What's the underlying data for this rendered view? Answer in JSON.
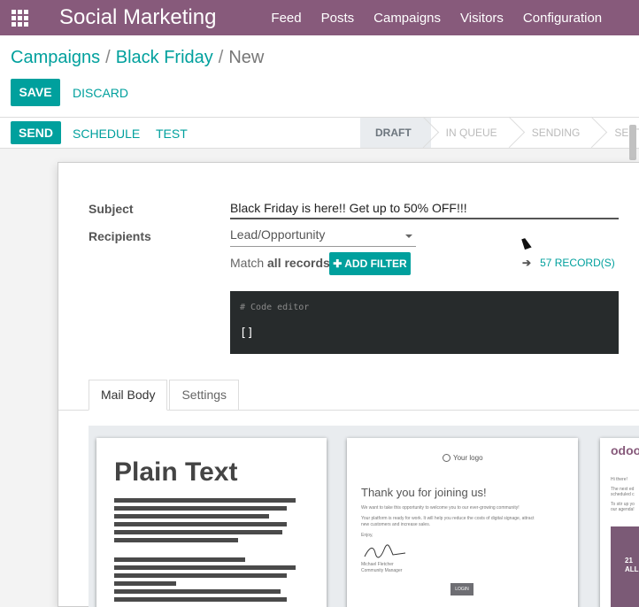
{
  "navbar": {
    "app_title": "Social Marketing",
    "menu": [
      {
        "label": "Feed"
      },
      {
        "label": "Posts"
      },
      {
        "label": "Campaigns"
      },
      {
        "label": "Visitors"
      },
      {
        "label": "Configuration"
      }
    ],
    "brand_color": "#875a7b"
  },
  "breadcrumb": {
    "items": [
      "Campaigns",
      "Black Friday"
    ],
    "current": "New",
    "separator": "/"
  },
  "actions": {
    "save_label": "SAVE",
    "discard_label": "DISCARD"
  },
  "statusbar": {
    "buttons": {
      "send": "SEND",
      "schedule": "SCHEDULE",
      "test": "TEST"
    },
    "stages": [
      {
        "label": "DRAFT",
        "active": true
      },
      {
        "label": "IN QUEUE",
        "active": false
      },
      {
        "label": "SENDING",
        "active": false
      },
      {
        "label": "SENT",
        "active": false
      }
    ]
  },
  "form": {
    "subject_label": "Subject",
    "subject_value": "Black Friday is here!! Get up to 50% OFF!!!",
    "recipients_label": "Recipients",
    "recipients_value": "Lead/Opportunity",
    "match_prefix": "Match",
    "match_bold": "all records",
    "add_filter_label": "ADD FILTER",
    "records_label": "57 RECORD(S)",
    "code_comment": "# Code editor",
    "code_value": "[]",
    "accent_color": "#00a09d"
  },
  "tabs": [
    {
      "label": "Mail Body",
      "active": true
    },
    {
      "label": "Settings",
      "active": false
    }
  ],
  "templates": {
    "plain_text_title": "Plain Text",
    "welcome_logo": "Your logo",
    "welcome_title": "Thank you for joining us!",
    "welcome_lines": [
      "We want to take this opportunity to welcome you to our ever-growing community!",
      "Your platform is ready for work. It will help you reduce the costs of digital signage, attract",
      "new customers and increase sales.",
      "Enjoy,"
    ],
    "signer_name": "Michael Fletcher",
    "signer_role": "Community Manager",
    "login_label": "LOGIN",
    "odoo_logo": "odoo",
    "third_lines": [
      "Hi there!",
      "The next ed",
      "scheduled c",
      "To stir up yo",
      "our agenda!"
    ],
    "third_banner_1": "21",
    "third_banner_2": "ALL C"
  }
}
